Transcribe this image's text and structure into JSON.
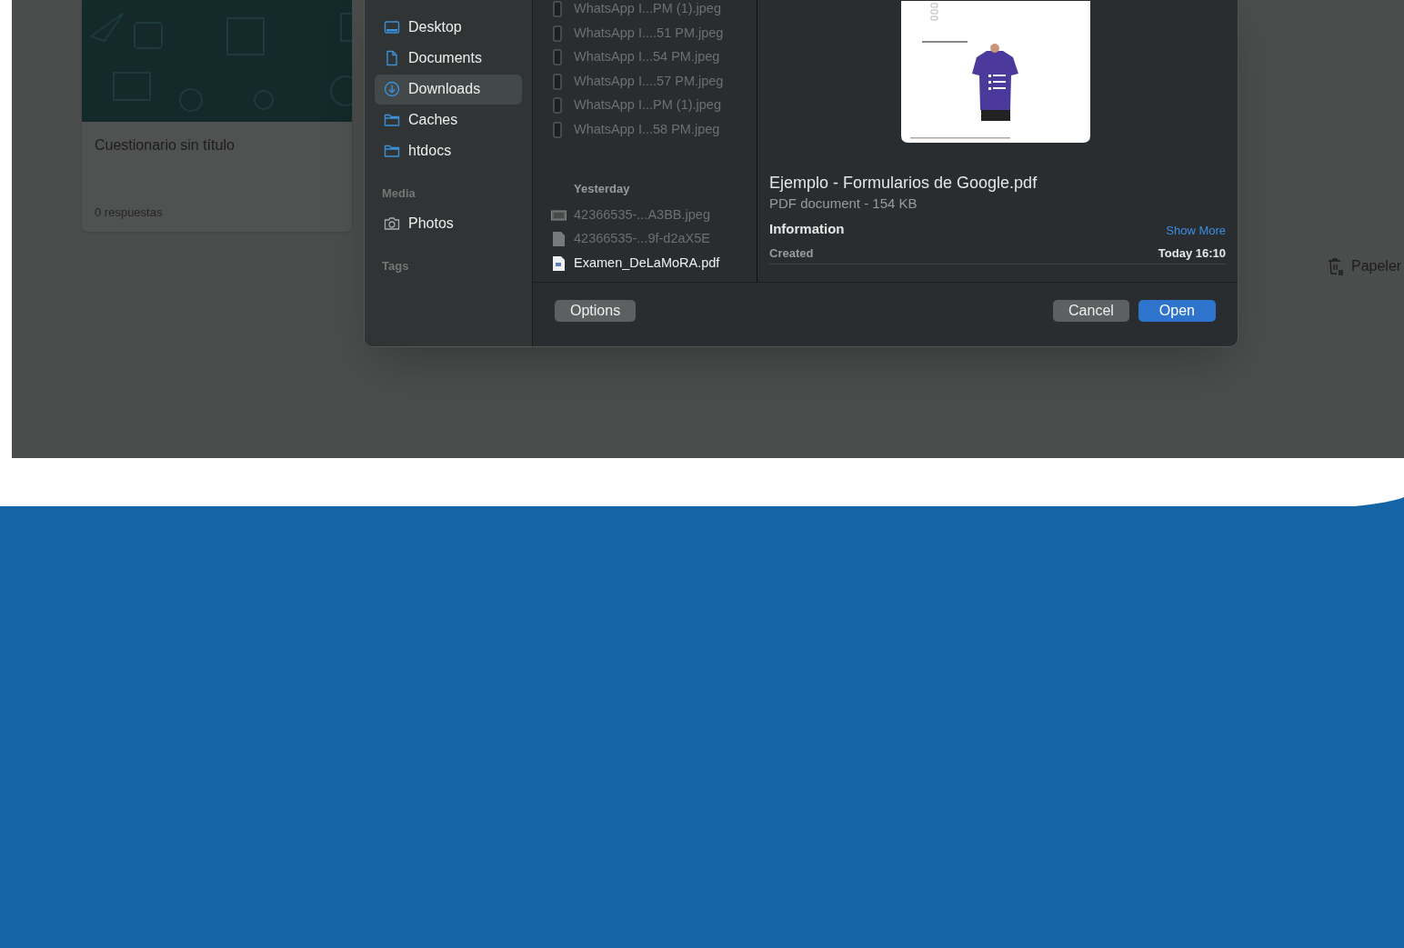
{
  "background_page": {
    "form_card": {
      "title": "Cuestionario sin título",
      "responses": "0 respuestas"
    },
    "trash_link": "Papeler"
  },
  "dialog": {
    "sidebar": [
      {
        "items": [
          {
            "label": "Desktop",
            "kind": "desktop",
            "selected": false
          },
          {
            "label": "Documents",
            "kind": "document",
            "selected": false
          },
          {
            "label": "Downloads",
            "kind": "download",
            "selected": true
          },
          {
            "label": "Caches",
            "kind": "folder",
            "selected": false
          },
          {
            "label": "htdocs",
            "kind": "folder",
            "selected": false
          }
        ]
      },
      {
        "heading": "Media",
        "items": [
          {
            "label": "Photos",
            "kind": "camera",
            "selected": false
          }
        ]
      },
      {
        "heading": "Tags"
      }
    ],
    "file_groups": [
      {
        "files": [
          {
            "name": "WhatsApp I...PM (1).jpeg",
            "kind": "phone",
            "disabled": true
          },
          {
            "name": "WhatsApp I....51 PM.jpeg",
            "kind": "phone",
            "disabled": true
          },
          {
            "name": "WhatsApp I...54 PM.jpeg",
            "kind": "phone",
            "disabled": true
          },
          {
            "name": "WhatsApp I....57 PM.jpeg",
            "kind": "phone",
            "disabled": true
          },
          {
            "name": "WhatsApp I...PM (1).jpeg",
            "kind": "phone",
            "disabled": true
          },
          {
            "name": "WhatsApp I...58 PM.jpeg",
            "kind": "phone",
            "disabled": true
          }
        ]
      },
      {
        "heading": "Yesterday",
        "files": [
          {
            "name": "42366535-...A3BB.jpeg",
            "kind": "image",
            "disabled": true
          },
          {
            "name": "42366535-...9f-d2aX5E",
            "kind": "document",
            "disabled": true
          },
          {
            "name": "Examen_DeLaMoRA.pdf",
            "kind": "pdf",
            "disabled": false
          }
        ]
      }
    ],
    "preview": {
      "title": "Ejemplo - Formularios de Google.pdf",
      "subtitle": "PDF document - 154 KB",
      "info_heading": "Information",
      "show_more": "Show More",
      "rows": [
        {
          "label": "Created",
          "value": "Today 16:10"
        }
      ]
    },
    "buttons": [
      {
        "label": "Options",
        "kind": "default"
      },
      {
        "label": "Cancel",
        "kind": "default"
      },
      {
        "label": "Open",
        "kind": "primary"
      }
    ]
  }
}
